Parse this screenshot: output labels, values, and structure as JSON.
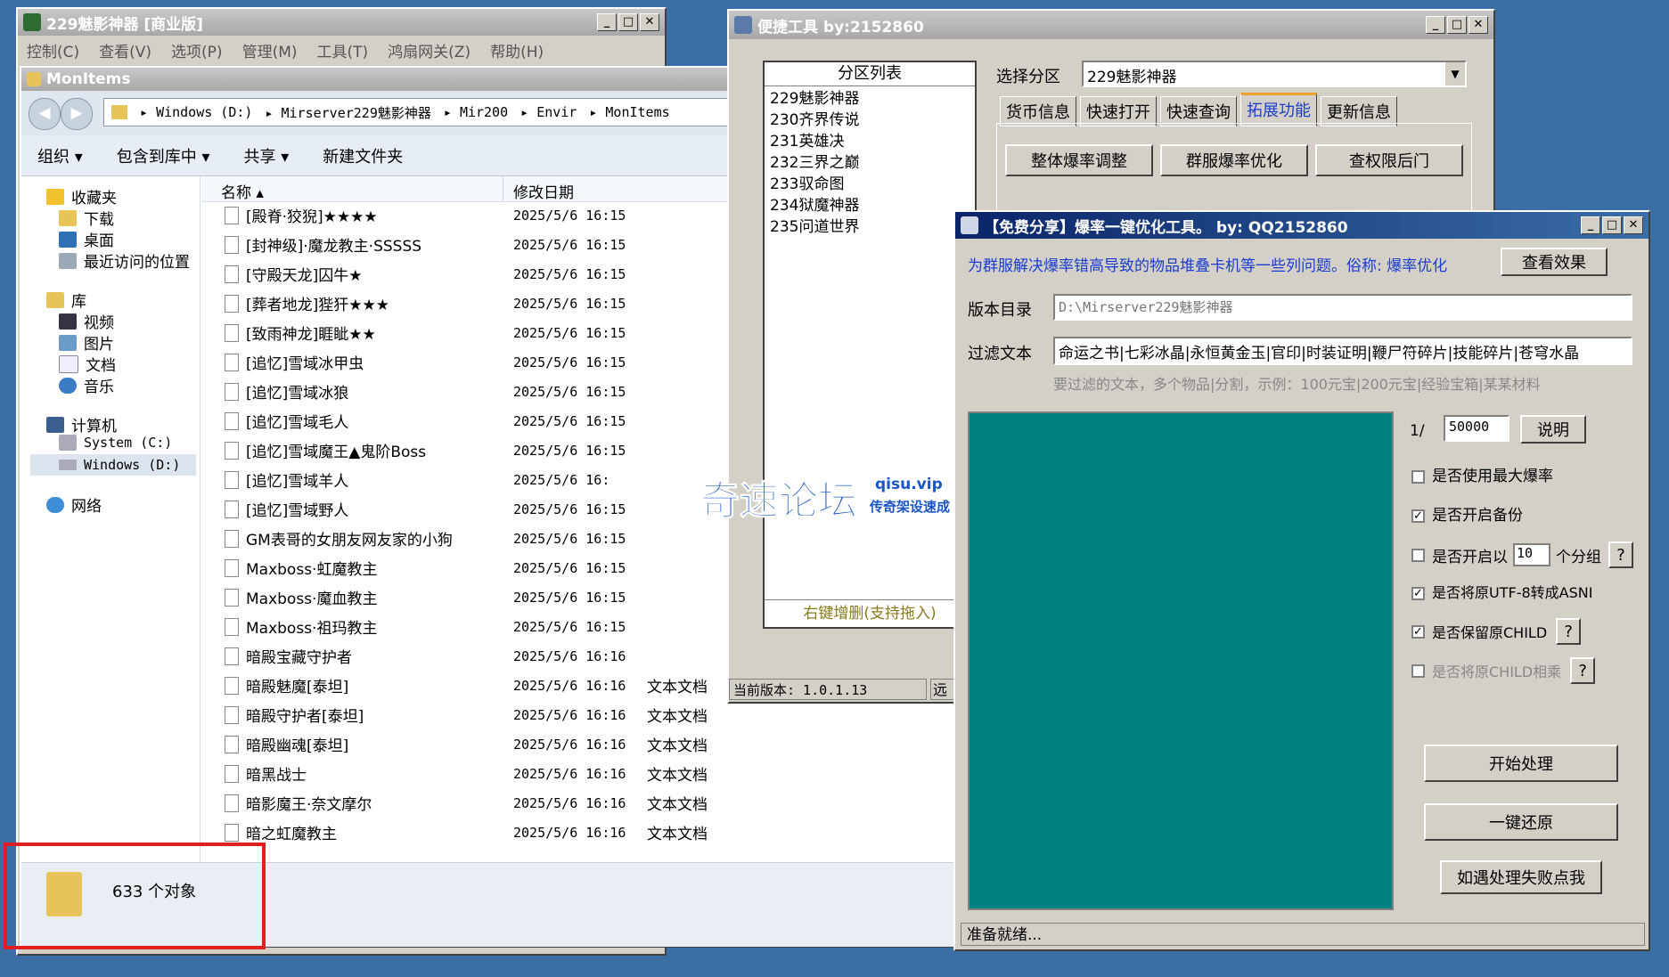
{
  "main_window": {
    "title": "229魅影神器 [商业版]"
  },
  "menu": [
    "控制(C)",
    "查看(V)",
    "选项(P)",
    "管理(M)",
    "工具(T)",
    "鸿扇网关(Z)",
    "帮助(H)"
  ],
  "explorer": {
    "title": "MonItems",
    "breadcrumb": [
      "Windows (D:)",
      "Mirserver229魅影神器",
      "Mir200",
      "Envir",
      "MonItems"
    ],
    "toolbar": [
      "组织",
      "包含到库中",
      "共享",
      "新建文件夹"
    ],
    "nav": {
      "favorites": "收藏夹",
      "downloads": "下载",
      "desktop": "桌面",
      "recent": "最近访问的位置",
      "libraries": "库",
      "videos": "视频",
      "pictures": "图片",
      "docs": "文档",
      "music": "音乐",
      "computer": "计算机",
      "sys_drive": "System (C:)",
      "win_drive": "Windows (D:)",
      "network": "网络"
    },
    "col_name": "名称",
    "col_date": "修改日期",
    "files": [
      {
        "name": "[殿脊·狡猊]★★★★",
        "date": "2025/5/6 16:15",
        "type": ""
      },
      {
        "name": "[封神级]·魔龙教主·SSSSS",
        "date": "2025/5/6 16:15",
        "type": ""
      },
      {
        "name": "[守殿天龙]囚牛★",
        "date": "2025/5/6 16:15",
        "type": ""
      },
      {
        "name": "[葬者地龙]狴犴★★★",
        "date": "2025/5/6 16:15",
        "type": ""
      },
      {
        "name": "[致雨神龙]睚眦★★",
        "date": "2025/5/6 16:15",
        "type": ""
      },
      {
        "name": "[追忆]雪域冰甲虫",
        "date": "2025/5/6 16:15",
        "type": ""
      },
      {
        "name": "[追忆]雪域冰狼",
        "date": "2025/5/6 16:15",
        "type": ""
      },
      {
        "name": "[追忆]雪域毛人",
        "date": "2025/5/6 16:15",
        "type": ""
      },
      {
        "name": "[追忆]雪域魔王▲鬼阶Boss",
        "date": "2025/5/6 16:15",
        "type": ""
      },
      {
        "name": "[追忆]雪域羊人",
        "date": "2025/5/6 16:",
        "type": ""
      },
      {
        "name": "[追忆]雪域野人",
        "date": "2025/5/6 16:15",
        "type": ""
      },
      {
        "name": "GM表哥的女朋友网友家的小狗",
        "date": "2025/5/6 16:15",
        "type": ""
      },
      {
        "name": "Maxboss·虹魔教主",
        "date": "2025/5/6 16:15",
        "type": ""
      },
      {
        "name": "Maxboss·魔血教主",
        "date": "2025/5/6 16:15",
        "type": ""
      },
      {
        "name": "Maxboss·祖玛教主",
        "date": "2025/5/6 16:15",
        "type": ""
      },
      {
        "name": "暗殿宝藏守护者",
        "date": "2025/5/6 16:16",
        "type": ""
      },
      {
        "name": "暗殿魅魔[泰坦]",
        "date": "2025/5/6 16:16",
        "type": "文本文档"
      },
      {
        "name": "暗殿守护者[泰坦]",
        "date": "2025/5/6 16:16",
        "type": "文本文档"
      },
      {
        "name": "暗殿幽魂[泰坦]",
        "date": "2025/5/6 16:16",
        "type": "文本文档"
      },
      {
        "name": "暗黑战士",
        "date": "2025/5/6 16:16",
        "type": "文本文档"
      },
      {
        "name": "暗影魔王·奈文摩尔",
        "date": "2025/5/6 16:16",
        "type": "文本文档"
      },
      {
        "name": "暗之虹魔教主",
        "date": "2025/5/6 16:16",
        "type": "文本文档"
      }
    ],
    "status": "633 个对象"
  },
  "quick_tool": {
    "title": "便捷工具   by:2152860",
    "partition_header": "分区列表",
    "partitions": [
      "229魅影神器",
      "230齐界传说",
      "231英雄决",
      "232三界之巅",
      "233驭命图",
      "234狱魔神器",
      "235问道世界"
    ],
    "partition_footer": "右键增删(支持拖入)",
    "select_label": "选择分区",
    "select_value": "229魅影神器",
    "tabs": [
      "货币信息",
      "快速打开",
      "快速查询",
      "拓展功能",
      "更新信息"
    ],
    "active_tab": "拓展功能",
    "buttons": [
      "整体爆率调整",
      "群服爆率优化",
      "查权限后门"
    ],
    "version": "当前版本: 1.0.1.13",
    "remote_btn": "远"
  },
  "optimizer": {
    "title": "【免费分享】爆率一键优化工具。   by: QQ2152860",
    "desc": "为群服解决爆率错高导致的物品堆叠卡机等一些列问题。俗称: 爆率优化",
    "view_btn": "查看效果",
    "dir_label": "版本目录",
    "dir_value": "D:\\Mirserver229魅影神器",
    "filter_label": "过滤文本",
    "filter_value": "命运之书|七彩冰晶|永恒黄金玉|官印|时装证明|鞭尸符碎片|技能碎片|苍穹水晶",
    "filter_hint": "要过滤的文本，多个物品|分割，示例：100元宝|200元宝|经验宝箱|某某材料",
    "ratio_prefix": "1/",
    "ratio_value": "50000",
    "explain_btn": "说明",
    "opt_max": "是否使用最大爆率",
    "opt_backup": "是否开启备份",
    "opt_group_pre": "是否开启以",
    "group_value": "10",
    "opt_group_post": "个分组",
    "opt_utf8": "是否将原UTF-8转成ASNI",
    "opt_keep_child": "是否保留原CHILD",
    "opt_mult_child": "是否将原CHILD相乘",
    "q": "?",
    "start_btn": "开始处理",
    "restore_btn": "一键还原",
    "fail_btn": "如遇处理失败点我",
    "status": "准备就绪..."
  },
  "watermark": {
    "main": "奇速论坛",
    "site": "qisu.vip",
    "sub": "传奇架设速成"
  }
}
